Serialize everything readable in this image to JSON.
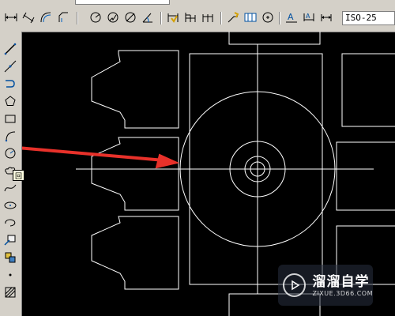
{
  "toolbar": {
    "dimstyle_value": "ISO-25",
    "style_combo_value": "",
    "top_partial_icons": [
      "layers-icon",
      "layer-state-icon",
      "color-icon"
    ],
    "dimension_buttons": [
      {
        "name": "linear-dimension-icon"
      },
      {
        "name": "aligned-dimension-icon"
      },
      {
        "name": "arc-length-icon"
      },
      {
        "name": "ordinate-dimension-icon"
      },
      {
        "name": "radius-dimension-icon"
      },
      {
        "name": "jogged-dimension-icon"
      },
      {
        "name": "diameter-dimension-icon"
      },
      {
        "name": "angular-dimension-icon"
      },
      {
        "name": "quick-dimension-icon"
      },
      {
        "name": "baseline-dimension-icon"
      },
      {
        "name": "continue-dimension-icon"
      },
      {
        "name": "quick-leader-icon"
      },
      {
        "name": "tolerance-icon"
      },
      {
        "name": "center-mark-icon"
      },
      {
        "name": "dimension-edit-icon"
      },
      {
        "name": "dimension-text-edit-icon"
      },
      {
        "name": "dimension-update-icon"
      }
    ]
  },
  "draw_toolbar": {
    "tools": [
      {
        "name": "line-icon"
      },
      {
        "name": "construction-line-icon"
      },
      {
        "name": "polyline-icon"
      },
      {
        "name": "polygon-icon"
      },
      {
        "name": "rectangle-icon"
      },
      {
        "name": "arc-icon"
      },
      {
        "name": "circle-icon"
      },
      {
        "name": "revision-cloud-icon"
      },
      {
        "name": "spline-icon"
      },
      {
        "name": "ellipse-icon"
      },
      {
        "name": "ellipse-arc-icon"
      },
      {
        "name": "insert-block-icon"
      },
      {
        "name": "make-block-icon"
      },
      {
        "name": "point-icon"
      },
      {
        "name": "hatch-icon"
      }
    ],
    "tooltip_text": "回"
  },
  "colors": {
    "canvas": "#000000",
    "geometry": "#ffffff",
    "arrow": "#e8312a",
    "toolbar_bg": "#d4d0c8"
  },
  "watermark": {
    "brand": "溜溜自学",
    "url": "ZIXUE.3D66.COM"
  }
}
